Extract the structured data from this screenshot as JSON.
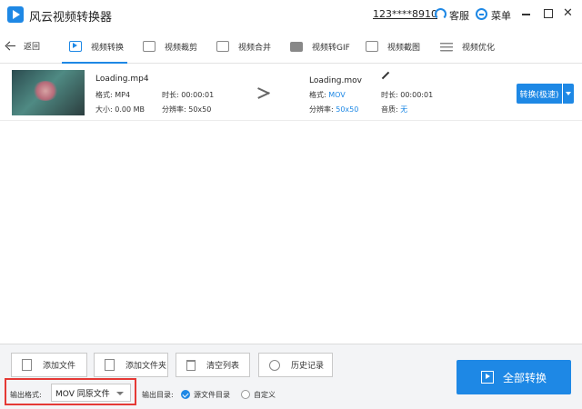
{
  "app": {
    "title": "风云视频转换器",
    "account": "123****8910",
    "service_label": "客服",
    "menu_label": "菜单"
  },
  "toolbar": {
    "back_label": "返回",
    "tabs": [
      {
        "label": "视频转换",
        "icon": "video-convert-icon"
      },
      {
        "label": "视频裁剪",
        "icon": "crop-icon"
      },
      {
        "label": "视频合并",
        "icon": "merge-icon"
      },
      {
        "label": "视频转GIF",
        "icon": "gif-icon"
      },
      {
        "label": "视频截图",
        "icon": "screenshot-icon"
      },
      {
        "label": "视频优化",
        "icon": "equalizer-icon"
      }
    ],
    "active_tab": "视频转换"
  },
  "file": {
    "source": {
      "name": "Loading.mp4",
      "format_label": "格式:",
      "format": "MP4",
      "duration_label": "时长:",
      "duration": "00:00:01",
      "size_label": "大小:",
      "size": "0.00 MB",
      "resolution_label": "分辨率:",
      "resolution": "50x50"
    },
    "target": {
      "name": "Loading.mov",
      "format_label": "格式:",
      "format": "MOV",
      "duration_label": "时长:",
      "duration": "00:00:01",
      "resolution_label": "分辨率:",
      "resolution": "50x50",
      "audio_label": "音质:",
      "audio": "无"
    },
    "convert_label": "转换(极速)"
  },
  "bottom": {
    "add_file": "添加文件",
    "add_folder": "添加文件夹",
    "clear_list": "清空列表",
    "history": "历史记录",
    "format_label": "输出格式:",
    "format_value": "MOV 同原文件",
    "dir_label": "输出目录:",
    "dir_options": [
      "源文件目录",
      "自定义"
    ],
    "dir_selected": "源文件目录",
    "convert_all": "全部转换"
  },
  "colors": {
    "accent": "#1e88e5",
    "highlight": "#e53935"
  }
}
